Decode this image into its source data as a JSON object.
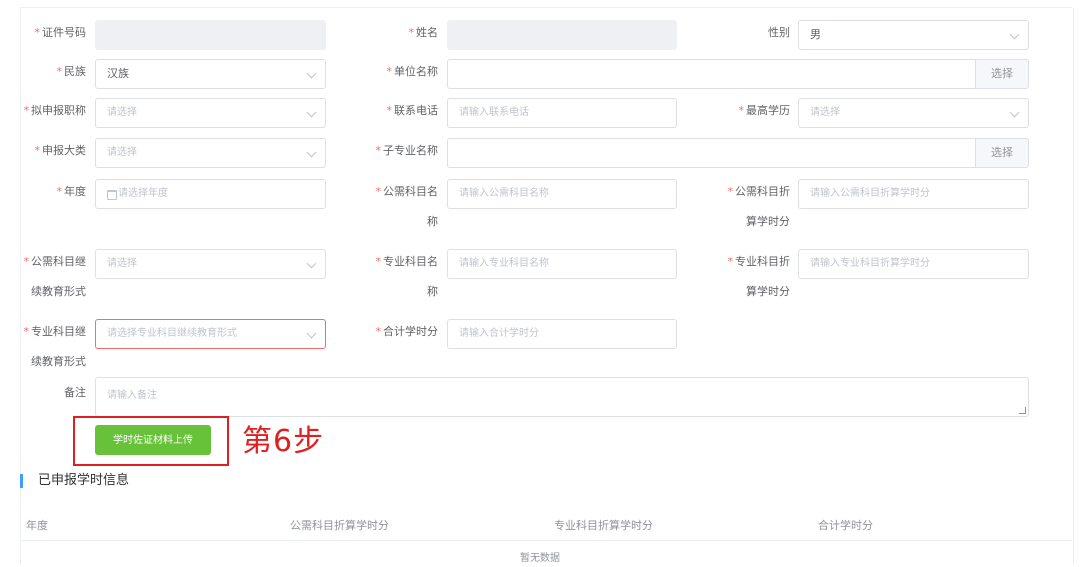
{
  "form": {
    "id_number": {
      "label": "证件号码",
      "value": ""
    },
    "name": {
      "label": "姓名",
      "value": ""
    },
    "gender": {
      "label": "性别",
      "value": "男"
    },
    "ethnicity": {
      "label": "民族",
      "value": "汉族"
    },
    "employer": {
      "label": "单位名称",
      "value": "",
      "button": "选择"
    },
    "title": {
      "label": "拟申报职称",
      "placeholder": "请选择"
    },
    "phone": {
      "label": "联系电话",
      "placeholder": "请输入联系电话"
    },
    "education": {
      "label": "最高学历",
      "placeholder": "请选择"
    },
    "category": {
      "label": "申报大类",
      "placeholder": "请选择"
    },
    "sub_major": {
      "label": "子专业名称",
      "value": "",
      "button": "选择"
    },
    "year": {
      "label": "年度",
      "placeholder": "请选择年度"
    },
    "public_course": {
      "label_line1": "公需科目名",
      "label_line2": "称",
      "placeholder": "请输入公需科目名称"
    },
    "public_hours": {
      "label_line1": "公需科目折",
      "label_line2": "算学时分",
      "placeholder": "请输入公需科目折算学时分"
    },
    "public_form": {
      "label_line1": "公需科目继",
      "label_line2": "续教育形式",
      "placeholder": "请选择"
    },
    "major_course": {
      "label_line1": "专业科目名",
      "label_line2": "称",
      "placeholder": "请输入专业科目名称"
    },
    "major_hours": {
      "label_line1": "专业科目折",
      "label_line2": "算学时分",
      "placeholder": "请输入专业科目折算学时分"
    },
    "major_form": {
      "label_line1": "专业科目继",
      "label_line2": "续教育形式",
      "placeholder": "请选择专业科目继续教育形式"
    },
    "total_hours": {
      "label": "合计学时分",
      "placeholder": "请输入合计学时分"
    },
    "remark": {
      "label": "备注",
      "placeholder": "请输入备注"
    }
  },
  "upload_button": "学时佐证材料上传",
  "step_annotation": "第6步",
  "section": {
    "title": "已申报学时信息",
    "columns": [
      "年度",
      "公需科目折算学时分",
      "专业科目折算学时分",
      "合计学时分"
    ],
    "empty_text": "暂无数据"
  },
  "colors": {
    "required": "#f56c6c",
    "primary": "#409eff",
    "success": "#67c23a",
    "annotation": "#e02020"
  }
}
